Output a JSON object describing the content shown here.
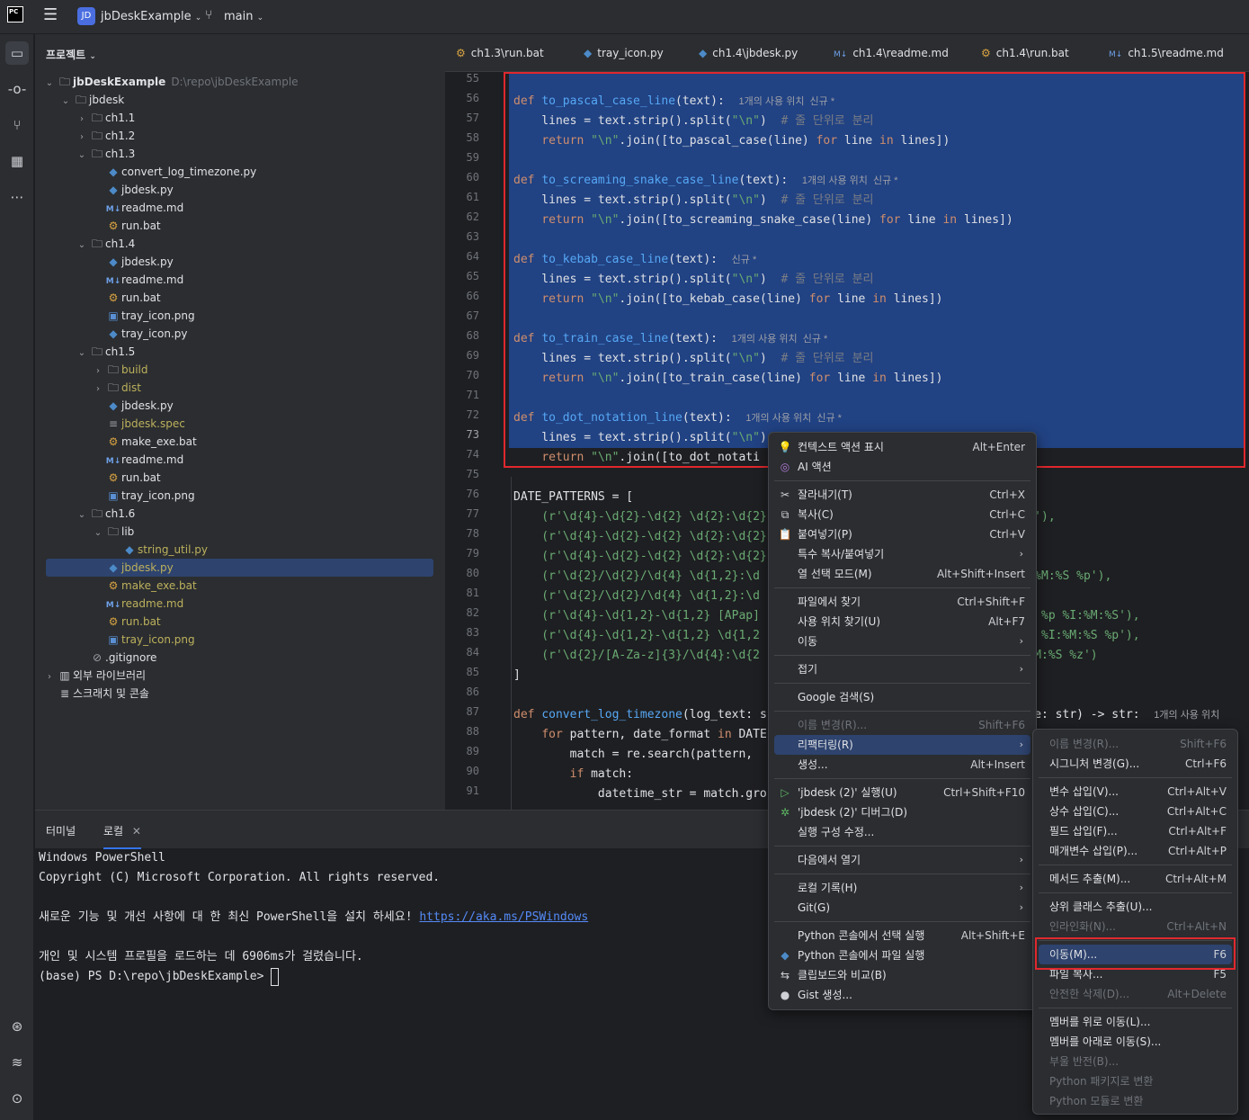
{
  "titlebar": {
    "logo": "PC",
    "project_badge": "JD",
    "project_name": "jbDeskExample",
    "branch": "main"
  },
  "panel": {
    "title": "프로젝트"
  },
  "tree": [
    {
      "label": "jbDeskExample",
      "extra": "D:\\repo\\jbDeskExample",
      "indent": 0,
      "arrow": "down",
      "icon": "folder"
    },
    {
      "label": "jbdesk",
      "indent": 1,
      "arrow": "down",
      "icon": "folder"
    },
    {
      "label": "ch1.1",
      "indent": 2,
      "arrow": "right",
      "icon": "folder"
    },
    {
      "label": "ch1.2",
      "indent": 2,
      "arrow": "right",
      "icon": "folder"
    },
    {
      "label": "ch1.3",
      "indent": 2,
      "arrow": "down",
      "icon": "folder"
    },
    {
      "label": "convert_log_timezone.py",
      "indent": 3,
      "icon": "py"
    },
    {
      "label": "jbdesk.py",
      "indent": 3,
      "icon": "py"
    },
    {
      "label": "readme.md",
      "indent": 3,
      "icon": "md"
    },
    {
      "label": "run.bat",
      "indent": 3,
      "icon": "bat"
    },
    {
      "label": "ch1.4",
      "indent": 2,
      "arrow": "down",
      "icon": "folder"
    },
    {
      "label": "jbdesk.py",
      "indent": 3,
      "icon": "py"
    },
    {
      "label": "readme.md",
      "indent": 3,
      "icon": "md"
    },
    {
      "label": "run.bat",
      "indent": 3,
      "icon": "bat"
    },
    {
      "label": "tray_icon.png",
      "indent": 3,
      "icon": "png"
    },
    {
      "label": "tray_icon.py",
      "indent": 3,
      "icon": "py"
    },
    {
      "label": "ch1.5",
      "indent": 2,
      "arrow": "down",
      "icon": "folder"
    },
    {
      "label": "build",
      "indent": 3,
      "arrow": "right",
      "icon": "folder",
      "yellow": true
    },
    {
      "label": "dist",
      "indent": 3,
      "arrow": "right",
      "icon": "folder",
      "yellow": true
    },
    {
      "label": "jbdesk.py",
      "indent": 3,
      "icon": "py"
    },
    {
      "label": "jbdesk.spec",
      "indent": 3,
      "icon": "spec",
      "yellow": true
    },
    {
      "label": "make_exe.bat",
      "indent": 3,
      "icon": "bat"
    },
    {
      "label": "readme.md",
      "indent": 3,
      "icon": "md"
    },
    {
      "label": "run.bat",
      "indent": 3,
      "icon": "bat"
    },
    {
      "label": "tray_icon.png",
      "indent": 3,
      "icon": "png"
    },
    {
      "label": "ch1.6",
      "indent": 2,
      "arrow": "down",
      "icon": "folder"
    },
    {
      "label": "lib",
      "indent": 3,
      "arrow": "down",
      "icon": "folder"
    },
    {
      "label": "string_util.py",
      "indent": 4,
      "icon": "py",
      "yellow": true
    },
    {
      "label": "jbdesk.py",
      "indent": 3,
      "icon": "py",
      "yellow": true,
      "selected": true
    },
    {
      "label": "make_exe.bat",
      "indent": 3,
      "icon": "bat",
      "yellow": true
    },
    {
      "label": "readme.md",
      "indent": 3,
      "icon": "md",
      "yellow": true
    },
    {
      "label": "run.bat",
      "indent": 3,
      "icon": "bat",
      "yellow": true
    },
    {
      "label": "tray_icon.png",
      "indent": 3,
      "icon": "png",
      "yellow": true
    },
    {
      "label": ".gitignore",
      "indent": 2,
      "icon": "gitignore"
    },
    {
      "label": "외부 라이브러리",
      "indent": 0,
      "arrow": "right",
      "icon": "lib"
    },
    {
      "label": "스크래치 및 콘솔",
      "indent": 0,
      "icon": "scratch"
    }
  ],
  "tabs": [
    {
      "label": "ch1.3\\run.bat",
      "icon": "bat"
    },
    {
      "label": "tray_icon.py",
      "icon": "py"
    },
    {
      "label": "ch1.4\\jbdesk.py",
      "icon": "py"
    },
    {
      "label": "ch1.4\\readme.md",
      "icon": "md"
    },
    {
      "label": "ch1.4\\run.bat",
      "icon": "bat"
    },
    {
      "label": "ch1.5\\readme.md",
      "icon": "md"
    }
  ],
  "line_numbers": [
    "55",
    "56",
    "57",
    "58",
    "59",
    "60",
    "61",
    "62",
    "63",
    "64",
    "65",
    "66",
    "67",
    "68",
    "69",
    "70",
    "71",
    "72",
    "73",
    "74",
    "75",
    "76",
    "77",
    "78",
    "79",
    "80",
    "81",
    "82",
    "83",
    "84",
    "85",
    "86",
    "87",
    "88",
    "89",
    "90",
    "91"
  ],
  "current_line": "73",
  "code": [
    [],
    [
      {
        "t": "def ",
        "c": "kw"
      },
      {
        "t": "to_pascal_case_line",
        "c": "fn"
      },
      {
        "t": "(text):  "
      },
      {
        "t": "1개의 사용 위치  신규 *",
        "c": "hint"
      }
    ],
    [
      {
        "t": "    lines = text.strip().split("
      },
      {
        "t": "\"\\n\"",
        "c": "st"
      },
      {
        "t": ")  "
      },
      {
        "t": "# 줄 단위로 분리",
        "c": "cm"
      }
    ],
    [
      {
        "t": "    "
      },
      {
        "t": "return ",
        "c": "kw"
      },
      {
        "t": "\"\\n\"",
        "c": "st"
      },
      {
        "t": ".join([to_pascal_case(line) "
      },
      {
        "t": "for ",
        "c": "kw"
      },
      {
        "t": "line "
      },
      {
        "t": "in ",
        "c": "kw"
      },
      {
        "t": "lines])"
      }
    ],
    [],
    [
      {
        "t": "def ",
        "c": "kw"
      },
      {
        "t": "to_screaming_snake_case_line",
        "c": "fn"
      },
      {
        "t": "(text):  "
      },
      {
        "t": "1개의 사용 위치  신규 *",
        "c": "hint"
      }
    ],
    [
      {
        "t": "    lines = text.strip().split("
      },
      {
        "t": "\"\\n\"",
        "c": "st"
      },
      {
        "t": ")  "
      },
      {
        "t": "# 줄 단위로 분리",
        "c": "cm"
      }
    ],
    [
      {
        "t": "    "
      },
      {
        "t": "return ",
        "c": "kw"
      },
      {
        "t": "\"\\n\"",
        "c": "st"
      },
      {
        "t": ".join([to_screaming_snake_case(line) "
      },
      {
        "t": "for ",
        "c": "kw"
      },
      {
        "t": "line "
      },
      {
        "t": "in ",
        "c": "kw"
      },
      {
        "t": "lines])"
      }
    ],
    [],
    [
      {
        "t": "def ",
        "c": "kw"
      },
      {
        "t": "to_kebab_case_line",
        "c": "fn"
      },
      {
        "t": "(text):  "
      },
      {
        "t": "신규 *",
        "c": "hint"
      }
    ],
    [
      {
        "t": "    lines = text.strip().split("
      },
      {
        "t": "\"\\n\"",
        "c": "st"
      },
      {
        "t": ")  "
      },
      {
        "t": "# 줄 단위로 분리",
        "c": "cm"
      }
    ],
    [
      {
        "t": "    "
      },
      {
        "t": "return ",
        "c": "kw"
      },
      {
        "t": "\"\\n\"",
        "c": "st"
      },
      {
        "t": ".join([to_kebab_case(line) "
      },
      {
        "t": "for ",
        "c": "kw"
      },
      {
        "t": "line "
      },
      {
        "t": "in ",
        "c": "kw"
      },
      {
        "t": "lines])"
      }
    ],
    [],
    [
      {
        "t": "def ",
        "c": "kw"
      },
      {
        "t": "to_train_case_line",
        "c": "fn"
      },
      {
        "t": "(text):  "
      },
      {
        "t": "1개의 사용 위치  신규 *",
        "c": "hint"
      }
    ],
    [
      {
        "t": "    lines = text.strip().split("
      },
      {
        "t": "\"\\n\"",
        "c": "st"
      },
      {
        "t": ")  "
      },
      {
        "t": "# 줄 단위로 분리",
        "c": "cm"
      }
    ],
    [
      {
        "t": "    "
      },
      {
        "t": "return ",
        "c": "kw"
      },
      {
        "t": "\"\\n\"",
        "c": "st"
      },
      {
        "t": ".join([to_train_case(line) "
      },
      {
        "t": "for ",
        "c": "kw"
      },
      {
        "t": "line "
      },
      {
        "t": "in ",
        "c": "kw"
      },
      {
        "t": "lines])"
      }
    ],
    [],
    [
      {
        "t": "def ",
        "c": "kw"
      },
      {
        "t": "to_dot_notation_line",
        "c": "fn"
      },
      {
        "t": "(text):  "
      },
      {
        "t": "1개의 사용 위치  신규 *",
        "c": "hint"
      }
    ],
    [
      {
        "t": "    lines = text.strip().split("
      },
      {
        "t": "\"\\n\"",
        "c": "st"
      },
      {
        "t": ")"
      }
    ],
    [
      {
        "t": "    "
      },
      {
        "t": "return ",
        "c": "kw"
      },
      {
        "t": "\"\\n\"",
        "c": "st"
      },
      {
        "t": ".join([to_dot_notati"
      }
    ],
    [],
    [
      {
        "t": "DATE_PATTERNS = ["
      }
    ],
    [
      {
        "t": "    (r'\\d{4}-\\d{2}-\\d{2} \\d{2}:\\d{2}",
        "c": "st"
      },
      {
        "t": "                                    %Z'),",
        "c": "st"
      }
    ],
    [
      {
        "t": "    (r'\\d{4}-\\d{2}-\\d{2} \\d{2}:\\d{2}",
        "c": "st"
      }
    ],
    [
      {
        "t": "    (r'\\d{4}-\\d{2}-\\d{2} \\d{2}:\\d{2}",
        "c": "st"
      }
    ],
    [
      {
        "t": "    (r'\\d{2}/\\d{2}/\\d{4} \\d{1,2}:\\d",
        "c": "st"
      },
      {
        "t": "                                     I:%M:%S %p'),",
        "c": "st"
      }
    ],
    [
      {
        "t": "    (r'\\d{2}/\\d{2}/\\d{4} \\d{1,2}:\\d",
        "c": "st"
      },
      {
        "t": "                                     ),",
        "c": "st"
      }
    ],
    [
      {
        "t": "    (r'\\d{4}-\\d{1,2}-\\d{1,2} [APap]",
        "c": "st"
      },
      {
        "t": "                                     %d %p %I:%M:%S'),",
        "c": "st"
      }
    ],
    [
      {
        "t": "    (r'\\d{4}-\\d{1,2}-\\d{1,2} \\d{1,2",
        "c": "st"
      },
      {
        "t": "                                     %d %I:%M:%S %p'),",
        "c": "st"
      }
    ],
    [
      {
        "t": "    (r'\\d{2}/[A-Za-z]{3}/\\d{4}:\\d{2",
        "c": "st"
      },
      {
        "t": "                                     :%M:%S %z')",
        "c": "st"
      }
    ],
    [
      {
        "t": "]"
      }
    ],
    [],
    [
      {
        "t": "def ",
        "c": "kw"
      },
      {
        "t": "convert_log_timezone",
        "c": "fn"
      },
      {
        "t": "(log_text: s"
      },
      {
        "t": "                                    one: str) -> str:  "
      },
      {
        "t": "1개의 사용 위치",
        "c": "hint"
      }
    ],
    [
      {
        "t": "    "
      },
      {
        "t": "for ",
        "c": "kw"
      },
      {
        "t": "pattern, date_format "
      },
      {
        "t": "in ",
        "c": "kw"
      },
      {
        "t": "DATE"
      }
    ],
    [
      {
        "t": "        match = re.search(pattern, "
      }
    ],
    [
      {
        "t": "        "
      },
      {
        "t": "if ",
        "c": "kw"
      },
      {
        "t": "match:"
      }
    ],
    [
      {
        "t": "            datetime_str = match.gro"
      }
    ]
  ],
  "terminal": {
    "tabs": [
      "터미널",
      "로컬"
    ],
    "lines": [
      "Windows PowerShell",
      "Copyright (C) Microsoft Corporation. All rights reserved.",
      "",
      "새로운 기능 및 개선 사항에 대 한 최신 PowerShell을 설치 하세요! ",
      "",
      "개인 및 시스템 프로필을 로드하는 데 6906ms가 걸렸습니다.",
      "(base) PS D:\\repo\\jbDeskExample> "
    ],
    "link": "https://aka.ms/PSWindows"
  },
  "context_menu": [
    {
      "label": "컨텍스트 액션 표시",
      "shortcut": "Alt+Enter",
      "icon": "bulb-icon"
    },
    {
      "label": "AI 액션",
      "icon": "ai-icon"
    },
    {
      "sep": true
    },
    {
      "label": "잘라내기(T)",
      "shortcut": "Ctrl+X",
      "icon": "scissors-icon"
    },
    {
      "label": "복사(C)",
      "shortcut": "Ctrl+C",
      "icon": "copy-icon"
    },
    {
      "label": "붙여넣기(P)",
      "shortcut": "Ctrl+V",
      "icon": "paste-icon"
    },
    {
      "label": "특수 복사/붙여넣기",
      "sub": true
    },
    {
      "label": "열 선택 모드(M)",
      "shortcut": "Alt+Shift+Insert"
    },
    {
      "sep": true
    },
    {
      "label": "파일에서 찾기",
      "shortcut": "Ctrl+Shift+F"
    },
    {
      "label": "사용 위치 찾기(U)",
      "shortcut": "Alt+F7"
    },
    {
      "label": "이동",
      "sub": true
    },
    {
      "sep": true
    },
    {
      "label": "접기",
      "sub": true
    },
    {
      "sep": true
    },
    {
      "label": "Google 검색(S)"
    },
    {
      "sep": true
    },
    {
      "label": "이름 변경(R)...",
      "shortcut": "Shift+F6",
      "disabled": true
    },
    {
      "label": "리팩터링(R)",
      "sub": true,
      "highlight": true
    },
    {
      "label": "생성...",
      "shortcut": "Alt+Insert"
    },
    {
      "sep": true
    },
    {
      "label": "'jbdesk (2)' 실행(U)",
      "shortcut": "Ctrl+Shift+F10",
      "icon": "run-icon"
    },
    {
      "label": "'jbdesk (2)' 디버그(D)",
      "icon": "debug-icon"
    },
    {
      "label": "실행 구성 수정..."
    },
    {
      "sep": true
    },
    {
      "label": "다음에서 열기",
      "sub": true
    },
    {
      "sep": true
    },
    {
      "label": "로컬 기록(H)",
      "sub": true
    },
    {
      "label": "Git(G)",
      "sub": true
    },
    {
      "sep": true
    },
    {
      "label": "Python 콘솔에서 선택 실행",
      "shortcut": "Alt+Shift+E"
    },
    {
      "label": "Python 콘솔에서 파일 실행",
      "icon": "python-icon"
    },
    {
      "label": "클립보드와 비교(B)",
      "icon": "compare-icon"
    },
    {
      "label": "Gist 생성...",
      "icon": "github-icon"
    }
  ],
  "refactor_menu": [
    {
      "label": "이름 변경(R)...",
      "shortcut": "Shift+F6",
      "disabled": true
    },
    {
      "label": "시그니처 변경(G)...",
      "shortcut": "Ctrl+F6"
    },
    {
      "sep": true
    },
    {
      "label": "변수 삽입(V)...",
      "shortcut": "Ctrl+Alt+V"
    },
    {
      "label": "상수 삽입(C)...",
      "shortcut": "Ctrl+Alt+C"
    },
    {
      "label": "필드 삽입(F)...",
      "shortcut": "Ctrl+Alt+F"
    },
    {
      "label": "매개변수 삽입(P)...",
      "shortcut": "Ctrl+Alt+P"
    },
    {
      "sep": true
    },
    {
      "label": "메서드 추출(M)...",
      "shortcut": "Ctrl+Alt+M"
    },
    {
      "sep": true
    },
    {
      "label": "상위 클래스 추출(U)..."
    },
    {
      "label": "인라인화(N)...",
      "shortcut": "Ctrl+Alt+N",
      "disabled": true
    },
    {
      "sep": true
    },
    {
      "label": "이동(M)...",
      "shortcut": "F6",
      "highlight": true
    },
    {
      "label": "파일 복사...",
      "shortcut": "F5"
    },
    {
      "label": "안전한 삭제(D)...",
      "shortcut": "Alt+Delete",
      "disabled": true
    },
    {
      "sep": true
    },
    {
      "label": "멤버를 위로 이동(L)..."
    },
    {
      "label": "멤버를 아래로 이동(S)..."
    },
    {
      "label": "부울 반전(B)...",
      "disabled": true
    },
    {
      "label": "Python 패키지로 변환",
      "disabled": true
    },
    {
      "label": "Python 모듈로 변환",
      "disabled": true
    }
  ]
}
